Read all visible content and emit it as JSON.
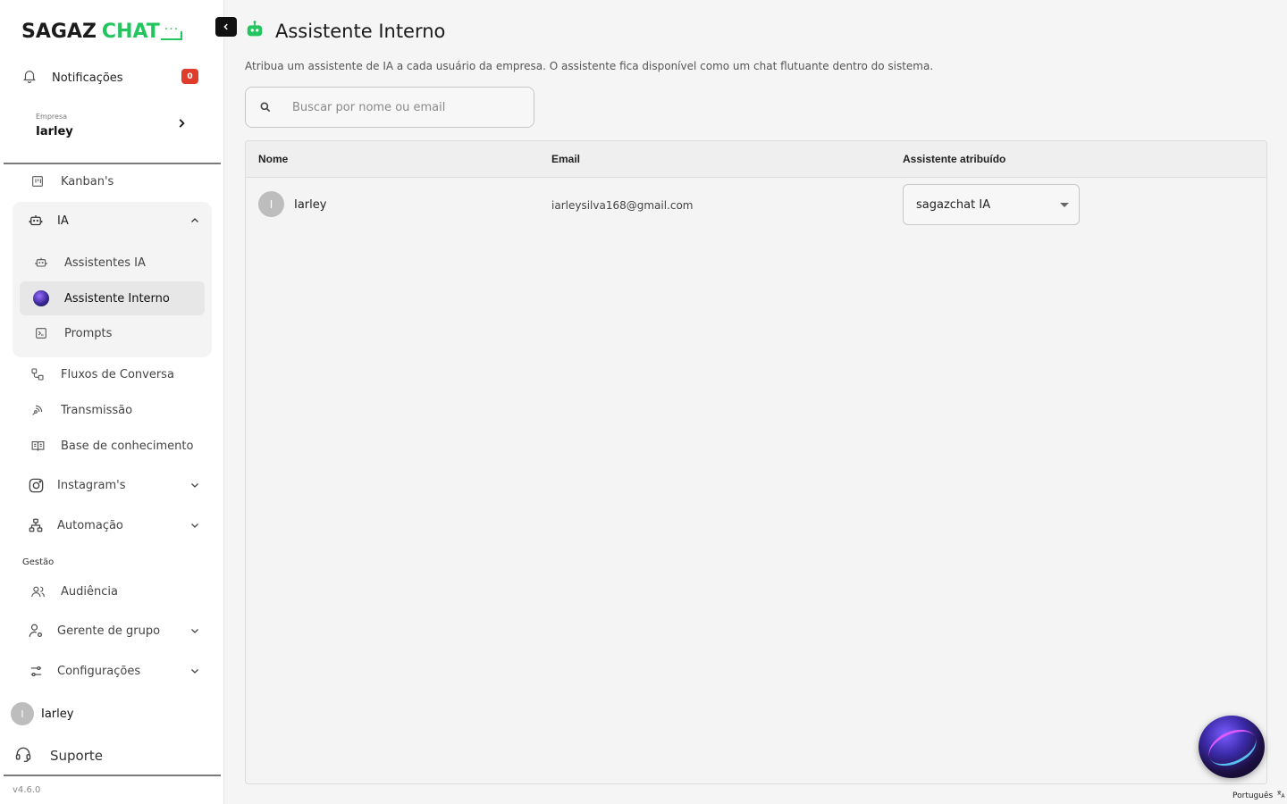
{
  "brand": {
    "part1": "SAGAZ",
    "part2": "CHAT"
  },
  "sidebar": {
    "notifications": {
      "label": "Notificações",
      "count": "0"
    },
    "company": {
      "caption": "Empresa",
      "name": "Iarley"
    },
    "items": {
      "kanban": "Kanban's",
      "ia": "IA",
      "assistentes": "Assistentes IA",
      "interno": "Assistente Interno",
      "prompts": "Prompts",
      "fluxos": "Fluxos de Conversa",
      "transmissao": "Transmissão",
      "base": "Base de conhecimento",
      "instagram": "Instagram's",
      "automacao": "Automação",
      "gestao_label": "Gestão",
      "audiencia": "Audiência",
      "gerente": "Gerente de grupo",
      "config": "Configurações"
    },
    "user": {
      "initial": "I",
      "name": "Iarley"
    },
    "support": "Suporte",
    "version": "v4.6.0"
  },
  "main": {
    "title": "Assistente Interno",
    "description": "Atribua um assistente de IA a cada usuário da empresa. O assistente fica disponível como um chat flutuante dentro do sistema.",
    "search_placeholder": "Buscar por nome ou email",
    "columns": {
      "name": "Nome",
      "email": "Email",
      "assistant": "Assistente atribuído"
    },
    "rows": [
      {
        "initial": "I",
        "name": "Iarley",
        "email": "iarleysilva168@gmail.com",
        "assistant": "sagazchat IA"
      }
    ]
  },
  "footer": {
    "language": "Português"
  },
  "colors": {
    "accent": "#22c55e",
    "badge": "#e03c2c"
  }
}
